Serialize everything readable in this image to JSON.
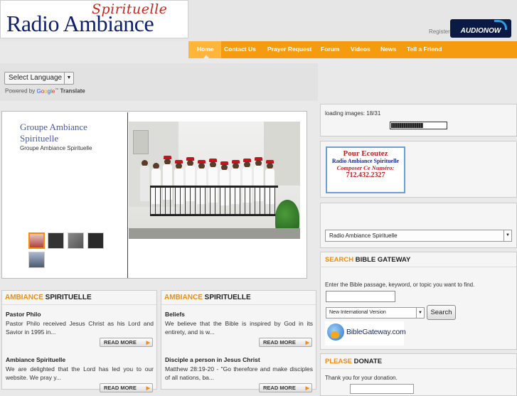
{
  "header": {
    "logo_script": "Spirituelle",
    "logo_main": "Radio Ambiance",
    "register_label": "Register",
    "audionow_label": "AUDIONOW"
  },
  "nav": {
    "items": [
      {
        "label": "Home",
        "active": true
      },
      {
        "label": "Contact Us"
      },
      {
        "label": "Prayer Request"
      },
      {
        "label": "Forum"
      },
      {
        "label": "Videos"
      },
      {
        "label": "News"
      },
      {
        "label": "Tell a Friend"
      }
    ]
  },
  "translate": {
    "select_label": "Select Language",
    "powered_by": "Powered by",
    "google": [
      "G",
      "o",
      "o",
      "g",
      "l",
      "e"
    ],
    "tm": "™",
    "translate_word": "Translate"
  },
  "feature": {
    "title": "Groupe Ambiance Spirituelle",
    "subtitle": "Groupe Ambiance Spirituelle"
  },
  "articles_left": {
    "head_highlight": "AMBIANCE",
    "head_rest": "SPIRITUELLE",
    "items": [
      {
        "title": "Pastor Philo",
        "text": "Pastor Philo received Jesus Christ as his Lord and Savior in 1995 in...",
        "readmore": "READ MORE"
      },
      {
        "title": "Ambiance Spirituelle",
        "text": "We are delighted that the Lord has led you to our website. We pray y...",
        "readmore": "READ MORE"
      }
    ]
  },
  "articles_right": {
    "head_highlight": "AMBIANCE",
    "head_rest": "SPIRITUELLE",
    "items": [
      {
        "title": "Beliefs",
        "text": "We believe that the Bible is inspired by God in its entirety, and is w...",
        "readmore": "READ MORE"
      },
      {
        "title": "Disciple a person in Jesus Christ",
        "text": "Matthew 28:19-20 - \"Go therefore and make disciples of all nations, ba...",
        "readmore": "READ MORE"
      }
    ]
  },
  "sidebar": {
    "loading_text": "loading images: 18/31",
    "loading_fraction": 0.58,
    "ad": {
      "line1": "Pour Ecoutez",
      "line2": "Radio Ambiance Spirituelle",
      "line3": "Composer Ce Numéro:",
      "line4": "712.432.2327"
    },
    "station_select": "Radio Ambiance Spirituelle",
    "bible": {
      "head_highlight": "SEARCH",
      "head_rest": "BIBLE GATEWAY",
      "description": "Enter the Bible passage, keyword, or topic you want to find.",
      "input_value": "",
      "version": "New International Version",
      "search_label": "Search",
      "logo_text": "BibleGateway.com"
    },
    "donate": {
      "head_highlight": "PLEASE",
      "head_rest": "DONATE",
      "text": "Thank you for your donation."
    }
  }
}
